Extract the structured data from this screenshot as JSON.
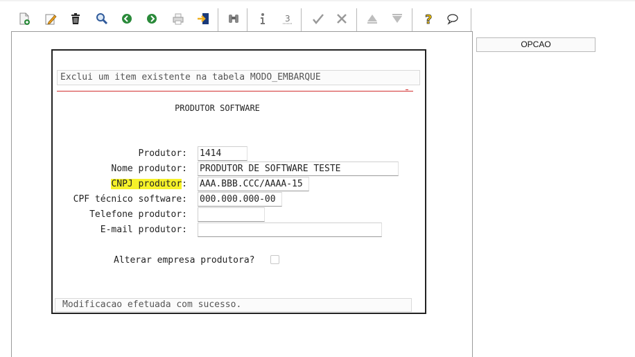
{
  "toolbar": {
    "icons": [
      "new-icon",
      "edit-icon",
      "delete-icon",
      "search-icon",
      "previous-icon",
      "next-icon",
      "print-icon",
      "exit-icon",
      "binoculars-icon",
      "info-icon",
      "underline-field-icon",
      "confirm-icon",
      "cancel-icon",
      "first-record-icon",
      "last-record-icon",
      "help-icon",
      "chat-icon"
    ],
    "accent": "#2a8a3a"
  },
  "dialog": {
    "top_message": "Exclui um item existente na tabela MODO_EMBARQUE",
    "title": "PRODUTOR SOFTWARE",
    "fields": {
      "produtor": {
        "label": "Produtor:",
        "value": "1414"
      },
      "nome": {
        "label": "Nome produtor:",
        "value": "PRODUTOR DE SOFTWARE TESTE"
      },
      "cnpj": {
        "label_highlighted": "CNPJ produtor",
        "label_suffix": ":",
        "value": "AAA.BBB.CCC/AAAA-15"
      },
      "cpf": {
        "label": "CPF técnico software:",
        "value": "000.000.000-00"
      },
      "telefone": {
        "label": "Telefone produtor:",
        "value": ""
      },
      "email": {
        "label": "E-mail produtor:",
        "value": ""
      }
    },
    "alterar_label": "Alterar empresa produtora?",
    "alterar_checked": false,
    "bottom_message": "Modificacao efetuada com sucesso."
  },
  "side": {
    "opcao_label": "OPCAO"
  },
  "colors": {
    "highlight": "#f6f22a",
    "separator_red": "#d23030"
  }
}
